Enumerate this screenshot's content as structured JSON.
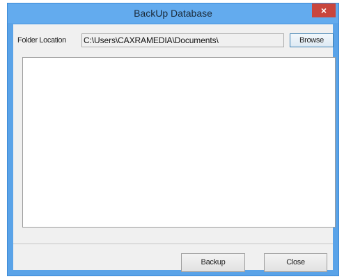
{
  "window": {
    "title": "BackUp Database",
    "close_glyph": "×"
  },
  "folder": {
    "label": "Folder Location",
    "path": "C:\\Users\\CAXRAMEDIA\\Documents\\",
    "browse_label": "Browse"
  },
  "log": {
    "content": ""
  },
  "footer": {
    "backup_label": "Backup",
    "close_label": "Close"
  },
  "colors": {
    "frame": "#5aa3e8",
    "close": "#c9463d",
    "client": "#f0f0f0"
  }
}
